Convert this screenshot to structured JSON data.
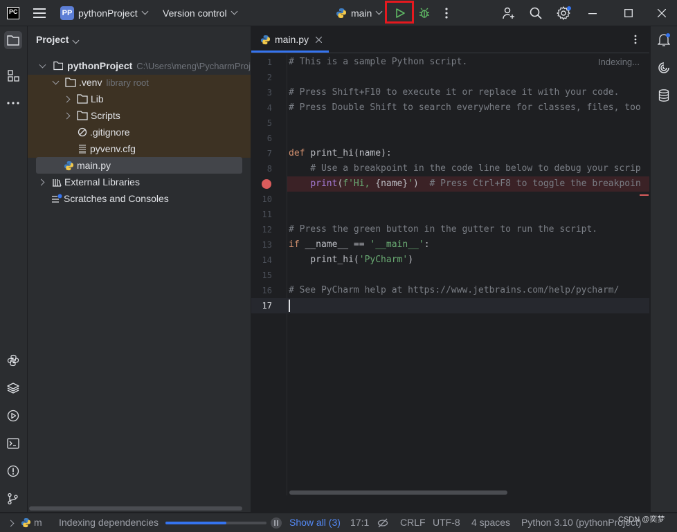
{
  "titlebar": {
    "project_badge": "PP",
    "project_name": "pythonProject",
    "vcs": "Version control",
    "run_config": "main"
  },
  "project_panel": {
    "title": "Project",
    "tree": [
      {
        "label": "pythonProject",
        "extra": "C:\\Users\\meng\\PycharmProj"
      },
      {
        "label": ".venv",
        "extra": "library root"
      },
      {
        "label": "Lib"
      },
      {
        "label": "Scripts"
      },
      {
        "label": ".gitignore"
      },
      {
        "label": "pyvenv.cfg"
      },
      {
        "label": "main.py"
      },
      {
        "label": "External Libraries"
      },
      {
        "label": "Scratches and Consoles"
      }
    ]
  },
  "editor": {
    "tab": "main.py",
    "indexing": "Indexing...",
    "line_numbers": [
      "1",
      "2",
      "3",
      "4",
      "5",
      "6",
      "7",
      "8",
      "9",
      "10",
      "11",
      "12",
      "13",
      "14",
      "15",
      "16",
      "17"
    ],
    "lines": {
      "l1": "# This is a sample Python script.",
      "l3": "# Press Shift+F10 to execute it or replace it with your code.",
      "l4": "# Press Double Shift to search everywhere for classes, files, too",
      "l7_kw": "def ",
      "l7_fn": "print_hi",
      "l7_rest": "(name):",
      "l8": "    # Use a breakpoint in the code line below to debug your scrip",
      "l9_indent": "    ",
      "l9_fn": "print",
      "l9_p1": "(",
      "l9_str1": "f'Hi, ",
      "l9_var": "{name}",
      "l9_str2": "'",
      "l9_p2": ")  ",
      "l9_cm": "# Press Ctrl+F8 to toggle the breakpoin",
      "l12": "# Press the green button in the gutter to run the script.",
      "l13_kw": "if ",
      "l13_mid": "__name__ == ",
      "l13_str": "'__main__'",
      "l13_end": ":",
      "l14_fn": "    print_hi(",
      "l14_str": "'PyCharm'",
      "l14_end": ")",
      "l16": "# See PyCharm help at https://www.jetbrains.com/help/pycharm/"
    }
  },
  "statusbar": {
    "branch": "m",
    "indexing_label": "Indexing dependencies",
    "indexing_progress": 0.6,
    "show_all": "Show all (3)",
    "position": "17:1",
    "line_sep": "CRLF",
    "encoding": "UTF-8",
    "indent": "4 spaces",
    "interpreter": "Python 3.10 (pythonProject)",
    "watermark": "CSDN @奕梦"
  },
  "colors": {
    "accent": "#3574f0",
    "run_green": "#5fb865",
    "highlight_red": "#e5191f",
    "breakpoint": "#db5c5c"
  }
}
